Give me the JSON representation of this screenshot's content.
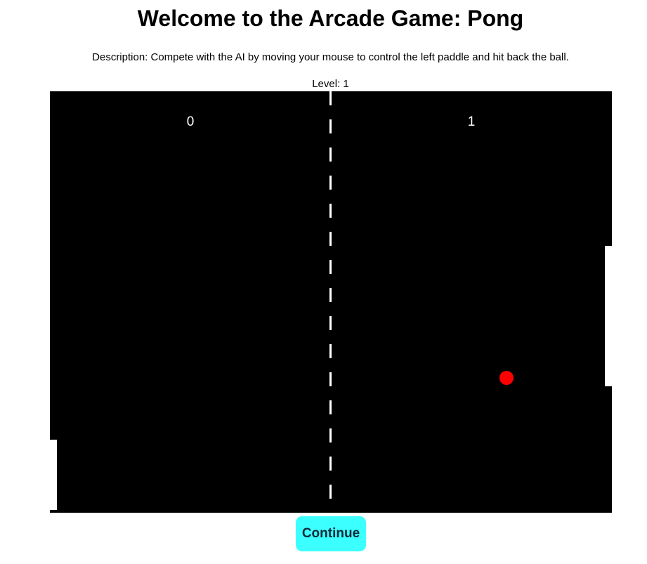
{
  "header": {
    "title": "Welcome to the Arcade Game: Pong",
    "description": "Description: Compete with the AI by moving your mouse to control the left paddle and hit back the ball.",
    "level_text": "Level: 1"
  },
  "game": {
    "score_left": "0",
    "score_right": "1",
    "level": 1,
    "colors": {
      "canvas": "#000000",
      "paddle": "#ffffff",
      "center_line": "#ffffff",
      "score": "#ffffff",
      "ball": "#ff0000"
    }
  },
  "controls": {
    "continue_label": "Continue",
    "continue_color": "#3cffff"
  }
}
